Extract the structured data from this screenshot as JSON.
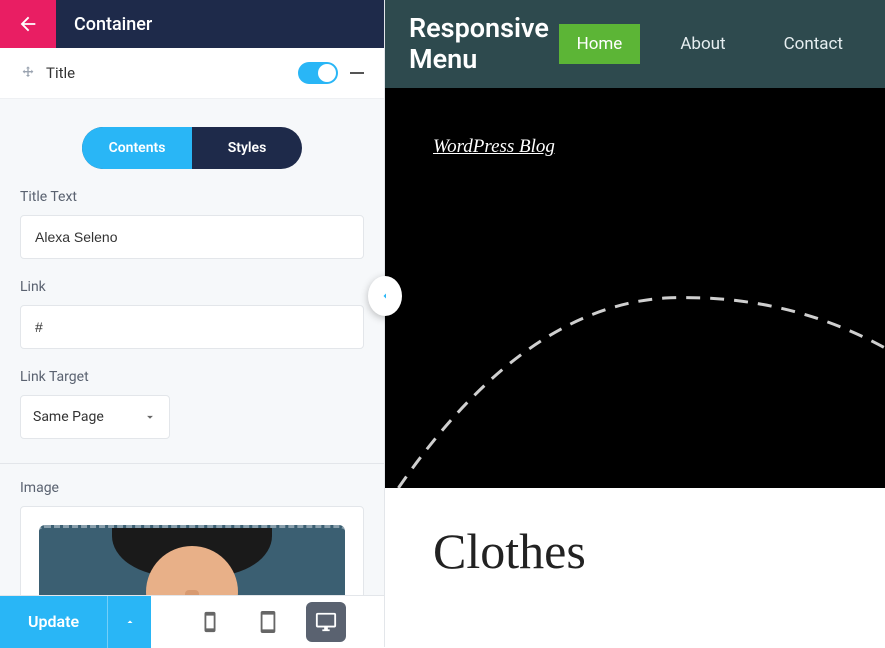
{
  "header": {
    "title": "Container"
  },
  "section": {
    "title": "Title"
  },
  "tabs": {
    "contents": "Contents",
    "styles": "Styles"
  },
  "fields": {
    "title_text": {
      "label": "Title Text",
      "value": "Alexa Seleno"
    },
    "link": {
      "label": "Link",
      "value": "#"
    },
    "link_target": {
      "label": "Link Target",
      "value": "Same Page"
    },
    "image": {
      "label": "Image"
    }
  },
  "footer": {
    "update": "Update"
  },
  "preview": {
    "brand": "Responsive Menu",
    "nav": {
      "home": "Home",
      "about": "About",
      "contact": "Contact"
    },
    "hero_link": "WordPress Blog",
    "content_title": "Clothes"
  }
}
